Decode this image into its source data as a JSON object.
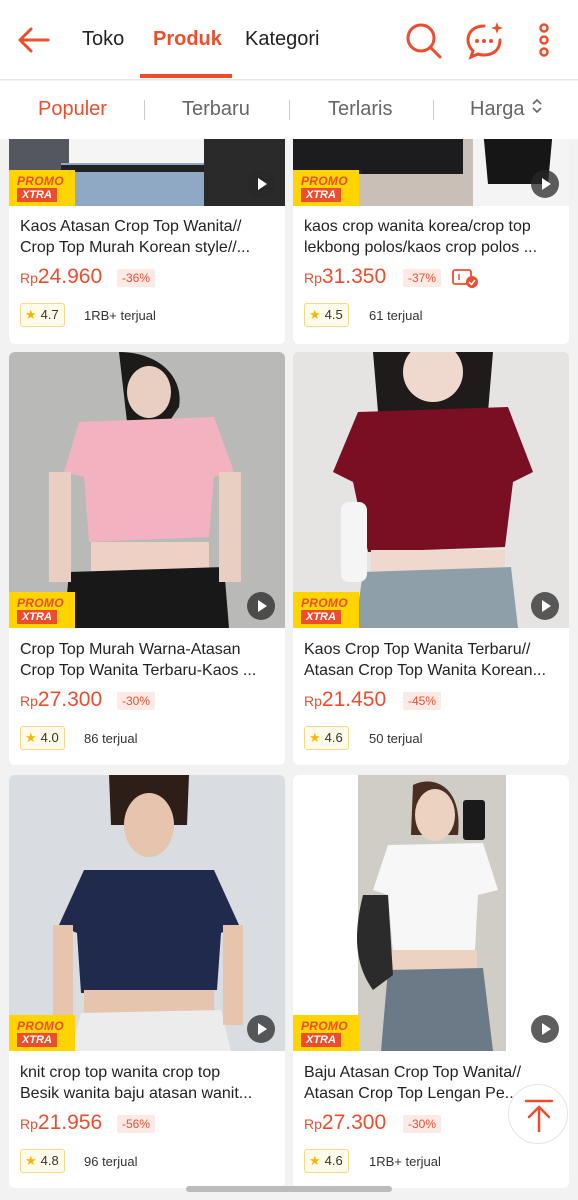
{
  "header": {
    "tabs": [
      {
        "label": "Toko"
      },
      {
        "label": "Produk"
      },
      {
        "label": "Kategori"
      }
    ],
    "icons": [
      "back-arrow-icon",
      "search-icon",
      "chat-icon",
      "more-vertical-icon"
    ]
  },
  "sortbar": {
    "items": [
      {
        "label": "Populer"
      },
      {
        "label": "Terbaru"
      },
      {
        "label": "Terlaris"
      },
      {
        "label": "Harga"
      }
    ]
  },
  "products": [
    {
      "title1": "Kaos Atasan Crop Top Wanita//",
      "title2": "Crop Top Murah Korean style//...",
      "currency": "Rp",
      "price": "24.960",
      "discount": "-36%",
      "rating": "4.7",
      "sold": "1RB+ terjual",
      "promo1": "PROMO",
      "promo2": "XTRA"
    },
    {
      "title1": "kaos crop wanita korea/crop top",
      "title2": "lekbong polos/kaos crop polos ...",
      "currency": "Rp",
      "price": "31.350",
      "discount": "-37%",
      "rating": "4.5",
      "sold": "61 terjual",
      "promo1": "PROMO",
      "promo2": "XTRA"
    },
    {
      "title1": "Crop Top Murah Warna-Atasan",
      "title2": "Crop Top Wanita Terbaru-Kaos ...",
      "currency": "Rp",
      "price": "27.300",
      "discount": "-30%",
      "rating": "4.0",
      "sold": "86 terjual",
      "promo1": "PROMO",
      "promo2": "XTRA"
    },
    {
      "title1": "Kaos Crop Top Wanita Terbaru//",
      "title2": "Atasan Crop Top Wanita Korean...",
      "currency": "Rp",
      "price": "21.450",
      "discount": "-45%",
      "rating": "4.6",
      "sold": "50 terjual",
      "promo1": "PROMO",
      "promo2": "XTRA"
    },
    {
      "title1": "knit crop top wanita crop top",
      "title2": "Besik wanita baju atasan wanit...",
      "currency": "Rp",
      "price": "21.956",
      "discount": "-56%",
      "rating": "4.8",
      "sold": "96 terjual",
      "promo1": "PROMO",
      "promo2": "XTRA"
    },
    {
      "title1": "Baju Atasan Crop Top Wanita//",
      "title2": "Atasan Crop Top Lengan Pe...",
      "currency": "Rp",
      "price": "27.300",
      "discount": "-30%",
      "rating": "4.6",
      "sold": "1RB+ terjual",
      "promo1": "PROMO",
      "promo2": "XTRA"
    }
  ],
  "colors": {
    "accent": "#ee4d2d",
    "promo_yellow": "#ffd400",
    "star": "#f8b400",
    "shirt_colors": [
      "#ffffff",
      "#1b1b1b",
      "#f3b2c0",
      "#7a0e22",
      "#1f2a4d",
      "#f7f7f7"
    ]
  }
}
